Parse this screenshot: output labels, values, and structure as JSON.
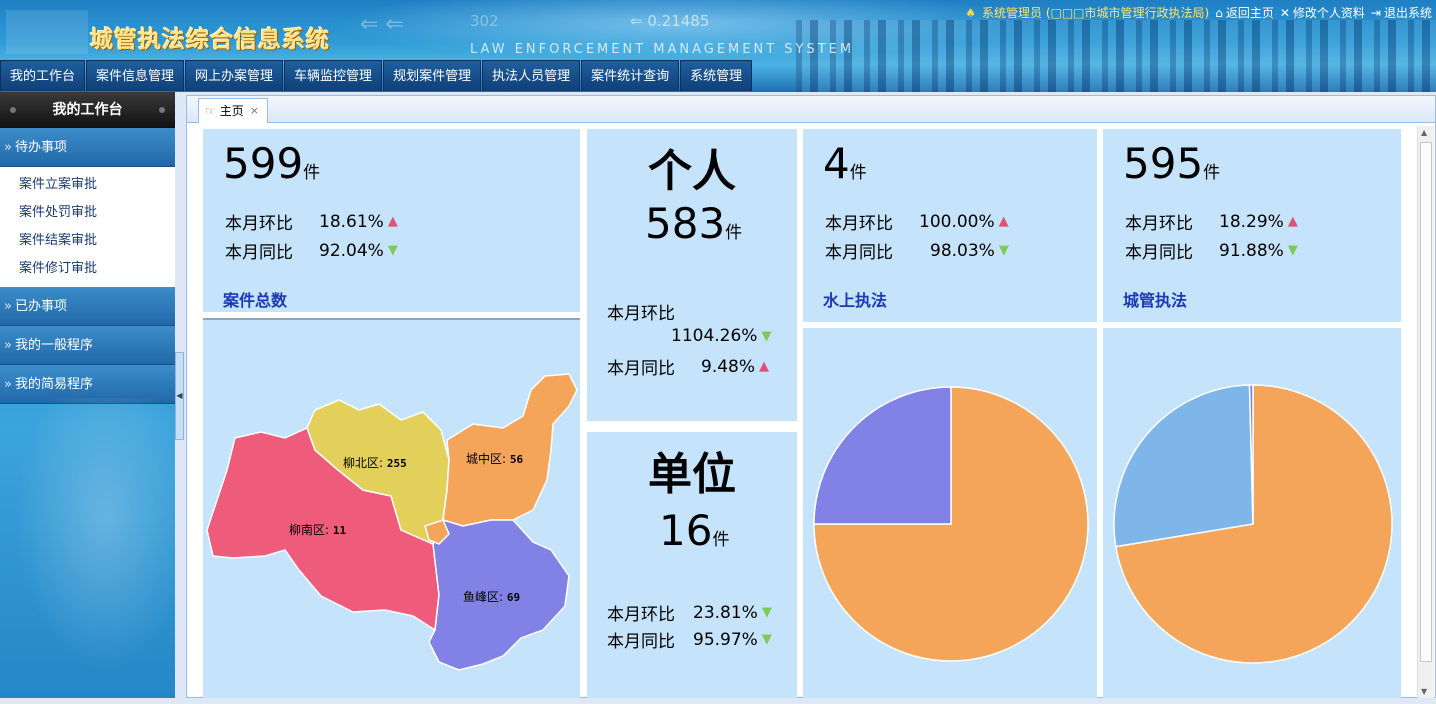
{
  "header": {
    "app_title": "城管执法综合信息系统",
    "subtitle": "LAW ENFORCEMENT MANAGEMENT SYSTEM",
    "deco_number": "0.21485",
    "deco_number2": "302",
    "user": "系统管理员 (□□□市城市管理行政执法局)",
    "links": [
      {
        "icon": "home-icon",
        "label": "返回主页"
      },
      {
        "icon": "tools-icon",
        "label": "修改个人资料"
      },
      {
        "icon": "logout-icon",
        "label": "退出系统"
      }
    ]
  },
  "topnav": [
    "我的工作台",
    "案件信息管理",
    "网上办案管理",
    "车辆监控管理",
    "规划案件管理",
    "执法人员管理",
    "案件统计查询",
    "系统管理"
  ],
  "sidebar": {
    "title": "我的工作台",
    "sections": [
      {
        "label": "待办事项",
        "items": [
          "案件立案审批",
          "案件处罚审批",
          "案件结案审批",
          "案件修订审批"
        ]
      },
      {
        "label": "已办事项"
      },
      {
        "label": "我的一般程序"
      },
      {
        "label": "我的简易程序"
      }
    ]
  },
  "tabs": [
    {
      "label": "主页",
      "close": "×"
    }
  ],
  "cards": {
    "total": {
      "value": "599",
      "unit": "件",
      "mom_label": "本月环比",
      "mom_value": "18.61%",
      "mom_dir": "▲",
      "yoy_label": "本月同比",
      "yoy_value": "92.04%",
      "yoy_dir": "▼",
      "title": "案件总数"
    },
    "personal": {
      "label": "个人",
      "value": "583",
      "unit": "件",
      "mom_label": "本月环比",
      "mom_value": "1104.26%",
      "mom_dir": "▼",
      "yoy_label": "本月同比",
      "yoy_value": "9.48%",
      "yoy_dir": "▲"
    },
    "unit": {
      "label": "单位",
      "value": "16",
      "unit": "件",
      "mom_label": "本月环比",
      "mom_value": "23.81%",
      "mom_dir": "▼",
      "yoy_label": "本月同比",
      "yoy_value": "95.97%",
      "yoy_dir": "▼"
    },
    "water": {
      "value": "4",
      "unit": "件",
      "mom_label": "本月环比",
      "mom_value": "100.00%",
      "mom_dir": "▲",
      "yoy_label": "本月同比",
      "yoy_value": "98.03%",
      "yoy_dir": "▼",
      "title": "水上执法"
    },
    "urban": {
      "value": "595",
      "unit": "件",
      "mom_label": "本月环比",
      "mom_value": "18.29%",
      "mom_dir": "▲",
      "yoy_label": "本月同比",
      "yoy_value": "91.88%",
      "yoy_dir": "▼",
      "title": "城管执法"
    }
  },
  "map": {
    "regions": [
      {
        "name": "柳北区",
        "value": "255",
        "color": "#e3d05a"
      },
      {
        "name": "城中区",
        "value": "56",
        "color": "#f5a55a"
      },
      {
        "name": "柳南区",
        "value": "11",
        "color": "#ef5b7b"
      },
      {
        "name": "鱼峰区",
        "value": "69",
        "color": "#8282e6"
      }
    ]
  },
  "chart_data": [
    {
      "type": "pie",
      "slices": [
        {
          "value": 75,
          "color": "#f5a55a"
        },
        {
          "value": 25,
          "color": "#8282e6"
        }
      ]
    },
    {
      "type": "pie",
      "slices": [
        {
          "value": 72.4,
          "color": "#f5a55a"
        },
        {
          "value": 27.2,
          "color": "#7fb6ea"
        },
        {
          "value": 0.4,
          "color": "#8282e6"
        }
      ]
    }
  ]
}
